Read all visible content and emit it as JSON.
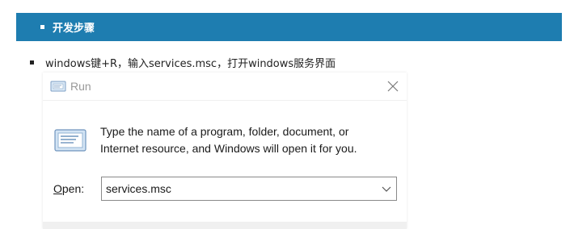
{
  "section": {
    "title": "开发步骤"
  },
  "instruction": {
    "text": "windows键+R，输入services.msc，打开windows服务界面"
  },
  "run_dialog": {
    "title": "Run",
    "description_line1": "Type the name of a program, folder, document, or",
    "description_line2": "Internet resource, and Windows will open it for you.",
    "open_label_accel": "O",
    "open_label_rest": "pen:",
    "open_value": "services.msc",
    "icons": {
      "title": "run-icon",
      "body": "run-icon",
      "close": "close-icon",
      "dropdown": "chevron-down-icon"
    }
  },
  "colors": {
    "header_bg": "#1e7db0",
    "header_text": "#ffffff"
  }
}
